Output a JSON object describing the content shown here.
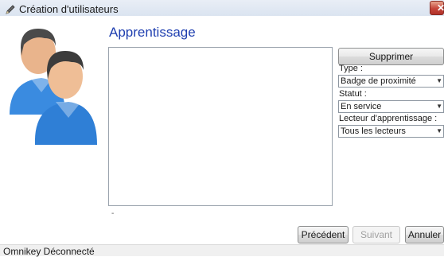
{
  "window": {
    "title": "Création d'utilisateurs",
    "close_glyph": "✕"
  },
  "page": {
    "heading": "Apprentissage"
  },
  "side_panel": {
    "delete_button": "Supprimer",
    "type_label": "Type :",
    "type_value": "Badge de proximité",
    "status_label": "Statut :",
    "status_value": "En service",
    "reader_label": "Lecteur d'apprentissage :",
    "reader_value": "Tous les lecteurs"
  },
  "list": {
    "note": "-"
  },
  "footer": {
    "previous": "Précédent",
    "next": "Suivant",
    "cancel": "Annuler"
  },
  "statusbar": {
    "text": "Omnikey Déconnecté"
  },
  "icons": {
    "app": "pencil-icon",
    "avatar": "users-icon",
    "caret": "chevron-down-icon"
  },
  "colors": {
    "heading": "#1f3fb0",
    "close": "#c6453a",
    "shirt": "#3a8be0"
  }
}
